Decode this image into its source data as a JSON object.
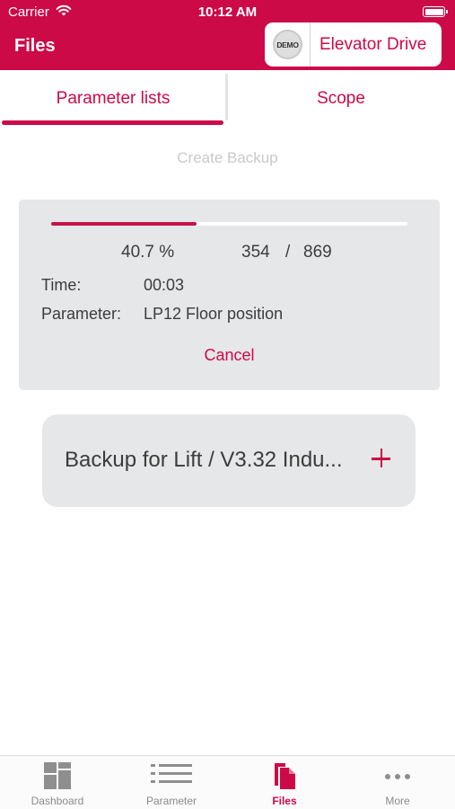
{
  "status_bar": {
    "carrier": "Carrier",
    "time": "10:12 AM"
  },
  "header": {
    "title": "Files",
    "device": {
      "badge": "DEMO",
      "name": "Elevator Drive"
    }
  },
  "tabs": [
    {
      "label": "Parameter lists",
      "active": true
    },
    {
      "label": "Scope",
      "active": false
    }
  ],
  "create_backup_label": "Create Backup",
  "progress": {
    "fraction": 0.407,
    "percent_text": "40.7 %",
    "current": "354",
    "separator": "/",
    "total": "869",
    "time_label": "Time:",
    "time_value": "00:03",
    "parameter_label": "Parameter:",
    "parameter_value": "LP12 Floor position",
    "cancel_label": "Cancel"
  },
  "backup_item": {
    "label": "Backup for Lift / V3.32 Indu...",
    "action_icon": "plus-icon"
  },
  "tab_bar": [
    {
      "label": "Dashboard",
      "icon": "dashboard-icon",
      "active": false
    },
    {
      "label": "Parameter",
      "icon": "list-icon",
      "active": false
    },
    {
      "label": "Files",
      "icon": "files-icon",
      "active": true
    },
    {
      "label": "More",
      "icon": "more-icon",
      "active": false
    }
  ],
  "colors": {
    "accent": "#cc0a48",
    "card_bg": "#e6e7e8",
    "disabled_text": "#c9c9c9"
  }
}
